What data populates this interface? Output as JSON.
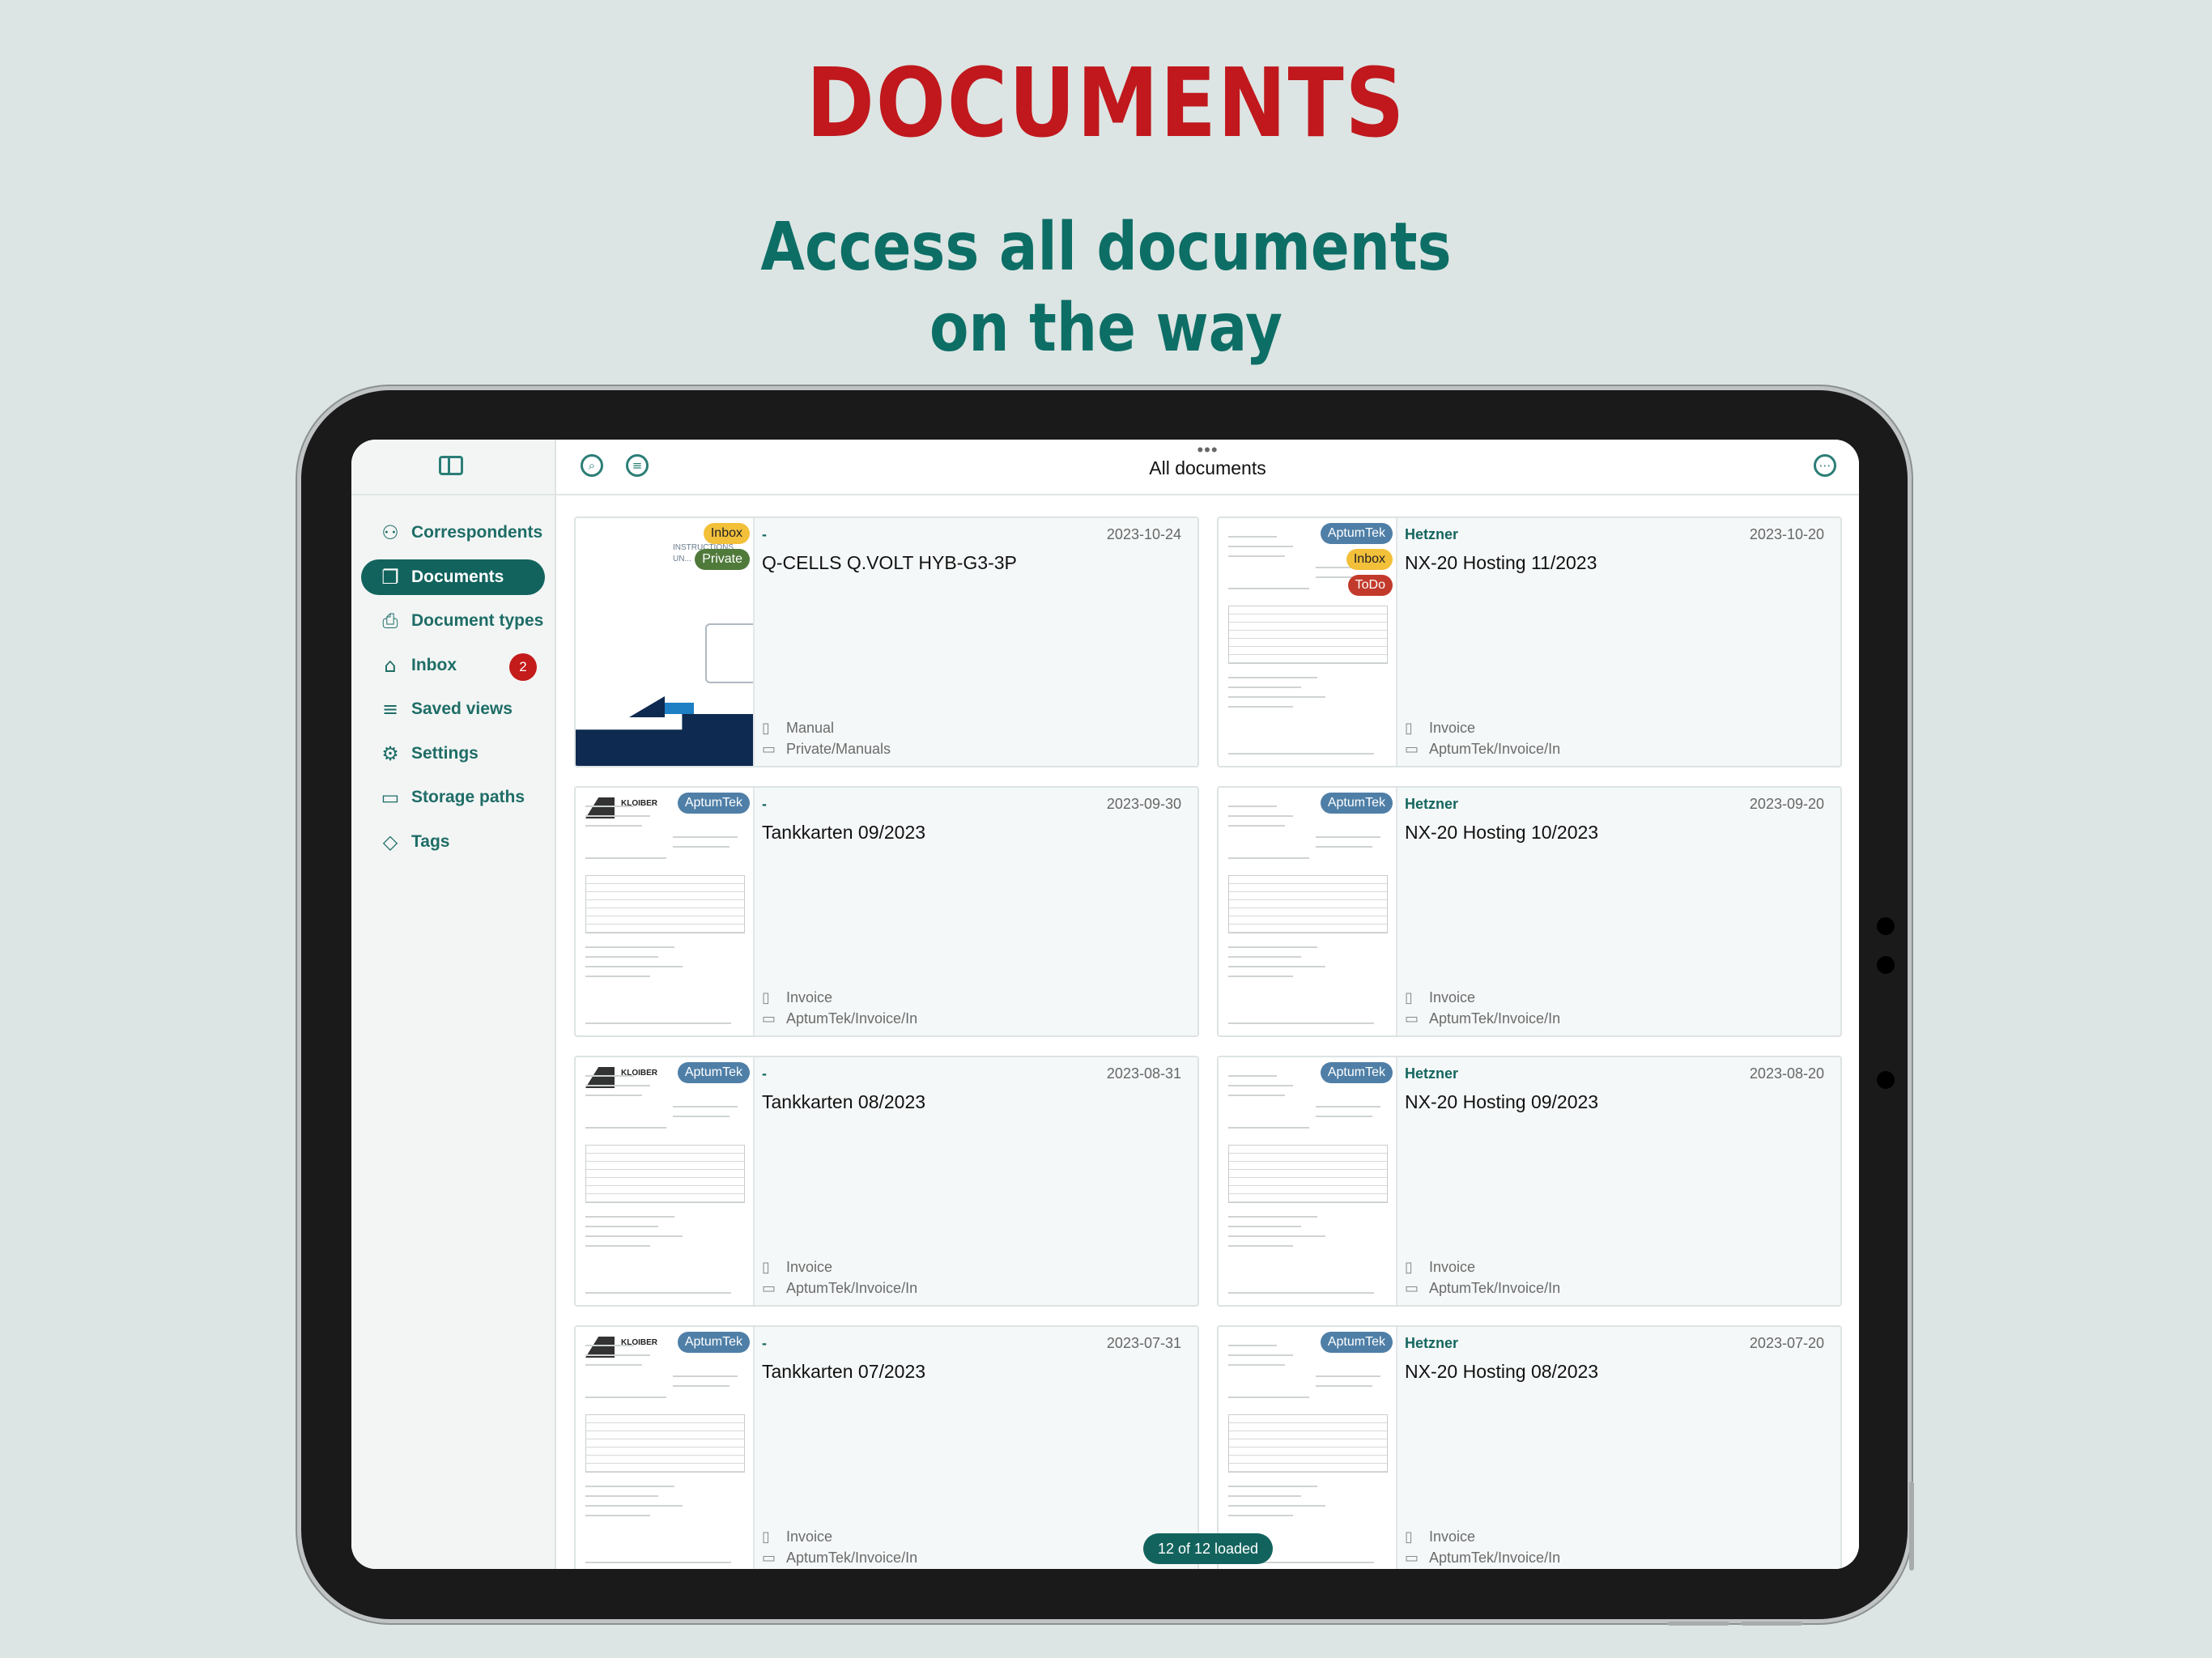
{
  "promo": {
    "title": "DOCUMENTS",
    "subtitle_line1": "Access all documents",
    "subtitle_line2": "on the way"
  },
  "colors": {
    "accent": "#12635d",
    "title_red": "#c0181d",
    "tag_inbox": "#f3c03a",
    "tag_private": "#4f7a3a",
    "tag_todo": "#c23a2b",
    "tag_aptumtek": "#4f7fa7",
    "badge_red": "#c41b1b"
  },
  "sidebar": {
    "toggle_icon": "sidebar-toggle-icon",
    "items": [
      {
        "label": "Correspondents",
        "icon": "person-icon",
        "glyph": "⚇"
      },
      {
        "label": "Documents",
        "icon": "documents-icon",
        "glyph": "❐",
        "active": true
      },
      {
        "label": "Document types",
        "icon": "document-type-icon",
        "glyph": "⎙"
      },
      {
        "label": "Inbox",
        "icon": "inbox-icon",
        "glyph": "⌂",
        "badge": "2"
      },
      {
        "label": "Saved views",
        "icon": "saved-views-icon",
        "glyph": "≡"
      },
      {
        "label": "Settings",
        "icon": "gear-icon",
        "glyph": "⚙"
      },
      {
        "label": "Storage paths",
        "icon": "folder-icon",
        "glyph": "▭"
      },
      {
        "label": "Tags",
        "icon": "tag-icon",
        "glyph": "◇"
      }
    ]
  },
  "topbar": {
    "title": "All documents",
    "handle": "•••",
    "search_icon": "search-icon",
    "filter_icon": "filter-icon",
    "more_icon": "more-icon"
  },
  "documents": [
    {
      "correspondent": "-",
      "date": "2023-10-24",
      "title": "Q-CELLS Q.VOLT HYB-G3-3P",
      "type": "Manual",
      "path": "Private/Manuals",
      "tags": [
        {
          "label": "Inbox",
          "kind": "inbox"
        },
        {
          "label": "Private",
          "kind": "private"
        }
      ],
      "thumb": "manual",
      "thumb_text": "INSTRUCTIONS UN..."
    },
    {
      "correspondent": "Hetzner",
      "date": "2023-10-20",
      "title": "NX-20 Hosting 11/2023",
      "type": "Invoice",
      "path": "AptumTek/Invoice/In",
      "tags": [
        {
          "label": "AptumTek",
          "kind": "aptumtek"
        },
        {
          "label": "Inbox",
          "kind": "inbox"
        },
        {
          "label": "ToDo",
          "kind": "todo"
        }
      ],
      "thumb": "hetzner"
    },
    {
      "correspondent": "-",
      "date": "2023-09-30",
      "title": "Tankkarten 09/2023",
      "type": "Invoice",
      "path": "AptumTek/Invoice/In",
      "tags": [
        {
          "label": "AptumTek",
          "kind": "aptumtek"
        }
      ],
      "thumb": "kloiber",
      "thumb_text": "KLOIBER"
    },
    {
      "correspondent": "Hetzner",
      "date": "2023-09-20",
      "title": "NX-20 Hosting 10/2023",
      "type": "Invoice",
      "path": "AptumTek/Invoice/In",
      "tags": [
        {
          "label": "AptumTek",
          "kind": "aptumtek"
        }
      ],
      "thumb": "hetzner"
    },
    {
      "correspondent": "-",
      "date": "2023-08-31",
      "title": "Tankkarten 08/2023",
      "type": "Invoice",
      "path": "AptumTek/Invoice/In",
      "tags": [
        {
          "label": "AptumTek",
          "kind": "aptumtek"
        }
      ],
      "thumb": "kloiber",
      "thumb_text": "KLOIBER"
    },
    {
      "correspondent": "Hetzner",
      "date": "2023-08-20",
      "title": "NX-20 Hosting 09/2023",
      "type": "Invoice",
      "path": "AptumTek/Invoice/In",
      "tags": [
        {
          "label": "AptumTek",
          "kind": "aptumtek"
        }
      ],
      "thumb": "hetzner"
    },
    {
      "correspondent": "-",
      "date": "2023-07-31",
      "title": "Tankkarten 07/2023",
      "type": "Invoice",
      "path": "AptumTek/Invoice/In",
      "tags": [
        {
          "label": "AptumTek",
          "kind": "aptumtek"
        }
      ],
      "thumb": "kloiber",
      "thumb_text": "KLOIBER"
    },
    {
      "correspondent": "Hetzner",
      "date": "2023-07-20",
      "title": "NX-20 Hosting 08/2023",
      "type": "Invoice",
      "path": "AptumTek/Invoice/In",
      "tags": [
        {
          "label": "AptumTek",
          "kind": "aptumtek"
        }
      ],
      "thumb": "hetzner"
    }
  ],
  "footer": {
    "loaded": "12 of 12 loaded"
  }
}
